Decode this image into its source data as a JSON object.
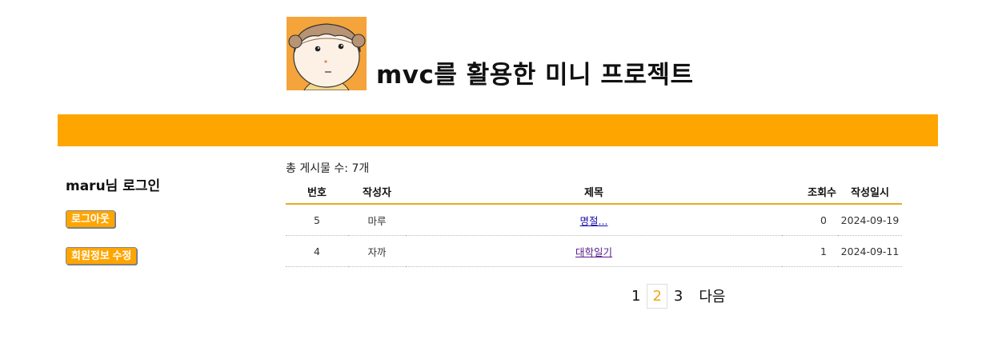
{
  "header": {
    "site_title": "mvc를 활용한 미니 프로젝트",
    "avatar_icon": "cartoon-face-icon"
  },
  "colors": {
    "accent": "#ffa500",
    "table_rule": "#e8a825",
    "avatar_bg": "#f4a43a",
    "current_page": "#f2a31d"
  },
  "sidebar": {
    "greeting": "maru님 로그인",
    "logout_label": "로그아웃",
    "edit_profile_label": "회원정보 수정"
  },
  "board": {
    "post_count": "총 게시물 수: 7개",
    "columns": [
      "번호",
      "작성자",
      "제목",
      "조회수",
      "작성일시"
    ],
    "rows": [
      {
        "no": "5",
        "writer": "마루",
        "title": "명절...",
        "views": "0",
        "date": "2024-09-19"
      },
      {
        "no": "4",
        "writer": "자까",
        "title": "대학일기",
        "views": "1",
        "date": "2024-09-11"
      }
    ]
  },
  "pagination": {
    "pages": [
      "1",
      "2",
      "3"
    ],
    "current": "2",
    "next_label": "다음"
  }
}
